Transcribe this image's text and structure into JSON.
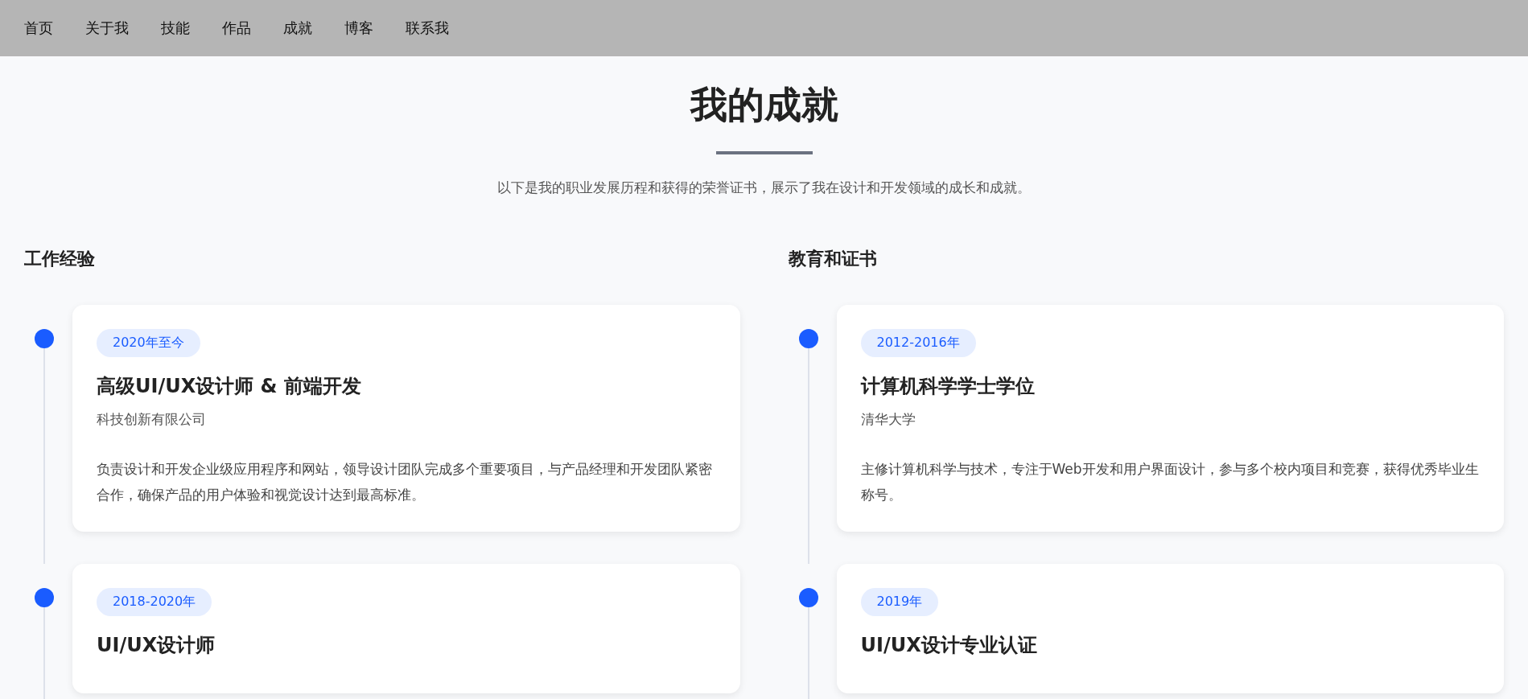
{
  "nav": {
    "items": [
      {
        "label": "首页"
      },
      {
        "label": "关于我"
      },
      {
        "label": "技能"
      },
      {
        "label": "作品"
      },
      {
        "label": "成就"
      },
      {
        "label": "博客"
      },
      {
        "label": "联系我"
      }
    ]
  },
  "header": {
    "title": "我的成就",
    "subtitle": "以下是我的职业发展历程和获得的荣誉证书，展示了我在设计和开发领域的成长和成就。"
  },
  "sections": [
    {
      "heading": "工作经验",
      "entries": [
        {
          "date": "2020年至今",
          "title": "高级UI/UX设计师 & 前端开发",
          "org": "科技创新有限公司",
          "description": "负责设计和开发企业级应用程序和网站，领导设计团队完成多个重要项目，与产品经理和开发团队紧密合作，确保产品的用户体验和视觉设计达到最高标准。"
        },
        {
          "date": "2018-2020年",
          "title": "UI/UX设计师"
        }
      ]
    },
    {
      "heading": "教育和证书",
      "entries": [
        {
          "date": "2012-2016年",
          "title": "计算机科学学士学位",
          "org": "清华大学",
          "description": "主修计算机科学与技术，专注于Web开发和用户界面设计，参与多个校内项目和竞赛，获得优秀毕业生称号。"
        },
        {
          "date": "2019年",
          "title": "UI/UX设计专业认证"
        }
      ]
    }
  ]
}
